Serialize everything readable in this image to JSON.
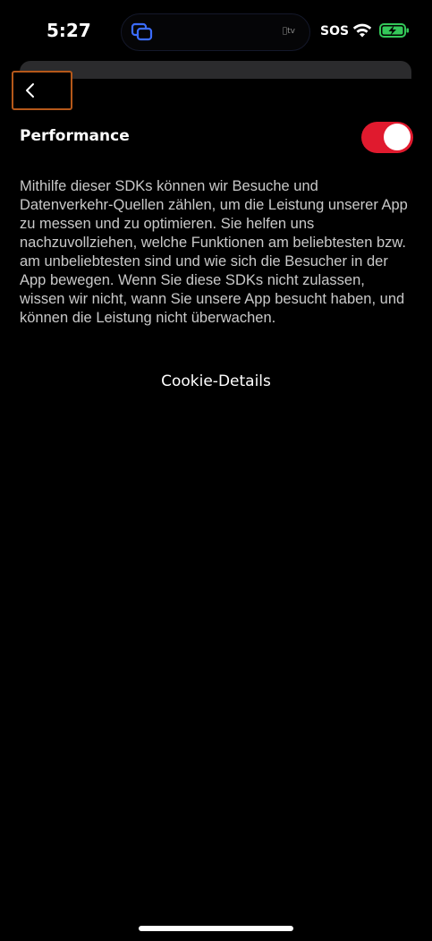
{
  "status_bar": {
    "time": "5:27",
    "sos": "SOS",
    "island_label": "tv",
    "battery_color": "#34c759"
  },
  "header": {
    "back_icon": "chevron-left-icon",
    "back_highlight_color": "#b5581a"
  },
  "section": {
    "title": "Performance",
    "toggle_on": true,
    "toggle_color": "#e01a2e",
    "description": "Mithilfe dieser SDKs können wir Besuche und Datenverkehr-Quellen zählen, um die Leistung unserer App zu messen und zu optimieren. Sie helfen uns nachzuvollziehen, welche Funktionen am beliebtesten bzw. am unbeliebtesten sind und wie sich die Besucher in der App bewegen. Wenn Sie diese SDKs nicht zulassen, wissen wir nicht, wann Sie unsere App besucht haben, und können die Leistung nicht überwachen."
  },
  "links": {
    "cookie_details": "Cookie-Details"
  }
}
